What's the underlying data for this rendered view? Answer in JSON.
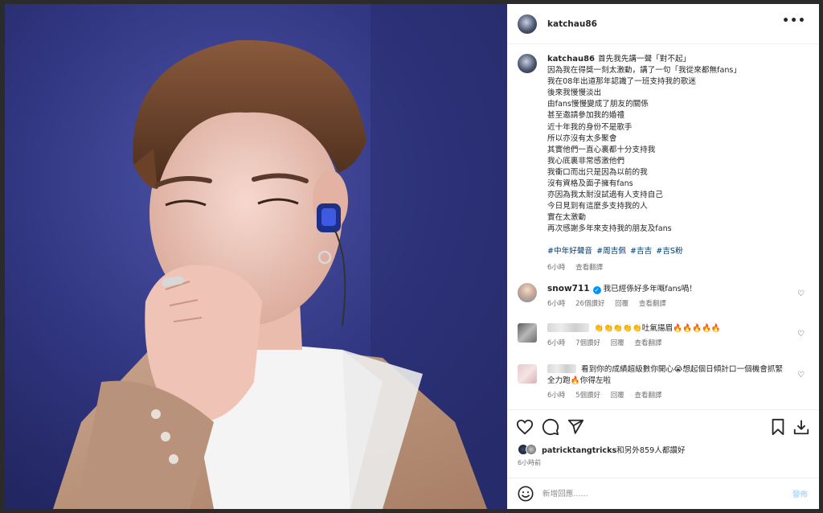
{
  "post": {
    "username": "katchau86",
    "more_icon": "more-horizontal-icon"
  },
  "caption": {
    "username": "katchau86",
    "lines": [
      "首先我先講一聲「對不起」",
      "因為我在得獎一刻太激動，講了一句「我從來都無fans」",
      "我在08年出道那年認識了一班支持我的歌迷",
      "後來我慢慢淡出",
      "由fans慢慢變成了朋友的關係",
      "甚至邀請參加我的婚禮",
      "近十年我的身份不是歌手",
      "所以亦沒有太多聚會",
      "其實他們一直心裏都十分支持我",
      "我心底裏非常感激他們",
      "我衝口而出只是因為以前的我",
      "沒有資格及面子擁有fans",
      "亦因為我太耐沒試過有人支持自己",
      "今日見到有這麼多支持我的人",
      "實在太激動",
      "再次感謝多年來支持我的朋友及fans"
    ],
    "hashtags": [
      "#中年好聲音",
      "#周吉佩",
      "#吉吉",
      "#吉S粉"
    ],
    "time": "6小時",
    "see_translation": "查看翻譯"
  },
  "comments": [
    {
      "username": "snow711",
      "verified": true,
      "text": "我已經係好多年嘅fans喎！",
      "time": "6小時",
      "likes": "26個讚好",
      "reply": "回覆",
      "see_translation": "查看翻譯"
    },
    {
      "username": "",
      "text": "👏👏👏👏👏吐氣揚眉🔥🔥🔥🔥🔥",
      "time": "6小時",
      "likes": "7個讚好",
      "reply": "回覆",
      "see_translation": "查看翻譯"
    },
    {
      "username": "",
      "text": "看到你的成績超級數你開心😭想起個日傾計口一個機會抓緊全力跑🔥你得左啦",
      "time": "6小時",
      "likes": "5個讚好",
      "reply": "回覆",
      "see_translation": "查看翻譯"
    }
  ],
  "actions": {
    "like_icon": "heart-icon",
    "comment_icon": "comment-icon",
    "share_icon": "send-icon",
    "save_icon": "bookmark-icon",
    "download_icon": "download-icon"
  },
  "likes": {
    "user": "patricktangtricks",
    "rest": "和另外859人都讚好"
  },
  "post_time": "6小時前",
  "add_comment": {
    "placeholder": "新增回應......",
    "post_label": "發佈",
    "emoji_icon": "emoji-icon"
  },
  "colors": {
    "accent": "#0095f6",
    "hashtag": "#00376b",
    "muted": "#737373",
    "post_disabled": "#b3dbff"
  }
}
